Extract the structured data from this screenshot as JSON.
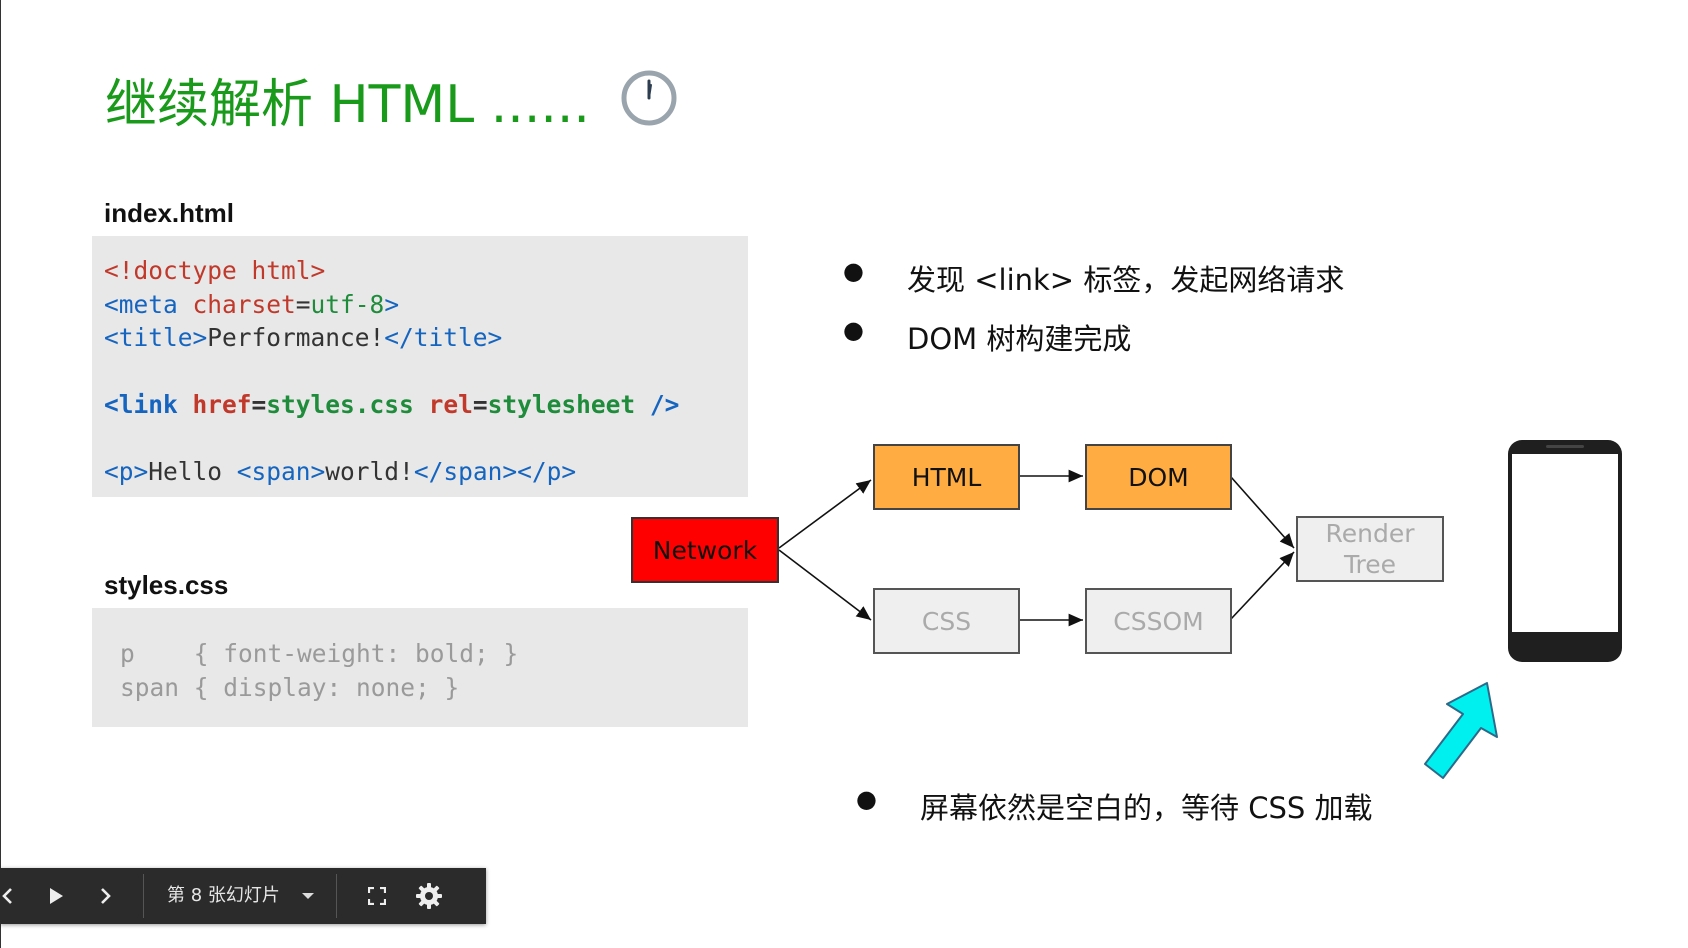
{
  "slide": {
    "title": "继续解析 HTML ......",
    "clock_icon": "clock-icon"
  },
  "html_file": {
    "label": "index.html",
    "lines": [
      [
        {
          "t": "<!doctype html>",
          "c": "red"
        }
      ],
      [
        {
          "t": "<meta ",
          "c": "blue"
        },
        {
          "t": "charset",
          "c": "red"
        },
        {
          "t": "=",
          "c": "dark"
        },
        {
          "t": "utf-8",
          "c": "green"
        },
        {
          "t": ">",
          "c": "blue"
        }
      ],
      [
        {
          "t": "<title>",
          "c": "blue"
        },
        {
          "t": "Performance!",
          "c": "dark"
        },
        {
          "t": "</title>",
          "c": "blue"
        }
      ],
      [
        {
          "t": " ",
          "c": "dark"
        }
      ],
      [
        {
          "t": "<link ",
          "c": "blue",
          "b": true
        },
        {
          "t": "href",
          "c": "red",
          "b": true
        },
        {
          "t": "=",
          "c": "dark",
          "b": true
        },
        {
          "t": "styles.css ",
          "c": "green",
          "b": true
        },
        {
          "t": "rel",
          "c": "red",
          "b": true
        },
        {
          "t": "=",
          "c": "dark",
          "b": true
        },
        {
          "t": "stylesheet ",
          "c": "green",
          "b": true
        },
        {
          "t": "/>",
          "c": "blue",
          "b": true
        }
      ],
      [
        {
          "t": " ",
          "c": "dark"
        }
      ],
      [
        {
          "t": "<p>",
          "c": "blue"
        },
        {
          "t": "Hello ",
          "c": "dark"
        },
        {
          "t": "<span>",
          "c": "blue"
        },
        {
          "t": "world!",
          "c": "dark"
        },
        {
          "t": "</span></p>",
          "c": "blue"
        }
      ]
    ]
  },
  "css_file": {
    "label": "styles.css",
    "lines": [
      [
        {
          "t": "p    { font-weight: bold; }",
          "c": "gray"
        }
      ],
      [
        {
          "t": "span { display: none; }",
          "c": "gray"
        }
      ]
    ]
  },
  "bullets_top": [
    "发现 <link> 标签，发起网络请求",
    "DOM 树构建完成"
  ],
  "bullet_dot": "●",
  "bullet_bottom": "屏幕依然是空白的，等待 CSS 加载",
  "diagram": {
    "network": "Network",
    "html": "HTML",
    "dom": "DOM",
    "css": "CSS",
    "cssom": "CSSOM",
    "render_tree": "Render Tree",
    "phone_icon": "phone-icon",
    "arrow_icon": "cyan-arrow-icon"
  },
  "toolbar": {
    "slide_label": "第 8 张幻灯片",
    "prev_icon": "chevron-left-icon",
    "play_icon": "play-icon",
    "next_icon": "chevron-right-icon",
    "dropdown_icon": "caret-down-icon",
    "fullscreen_icon": "fullscreen-icon",
    "settings_icon": "gear-icon"
  }
}
